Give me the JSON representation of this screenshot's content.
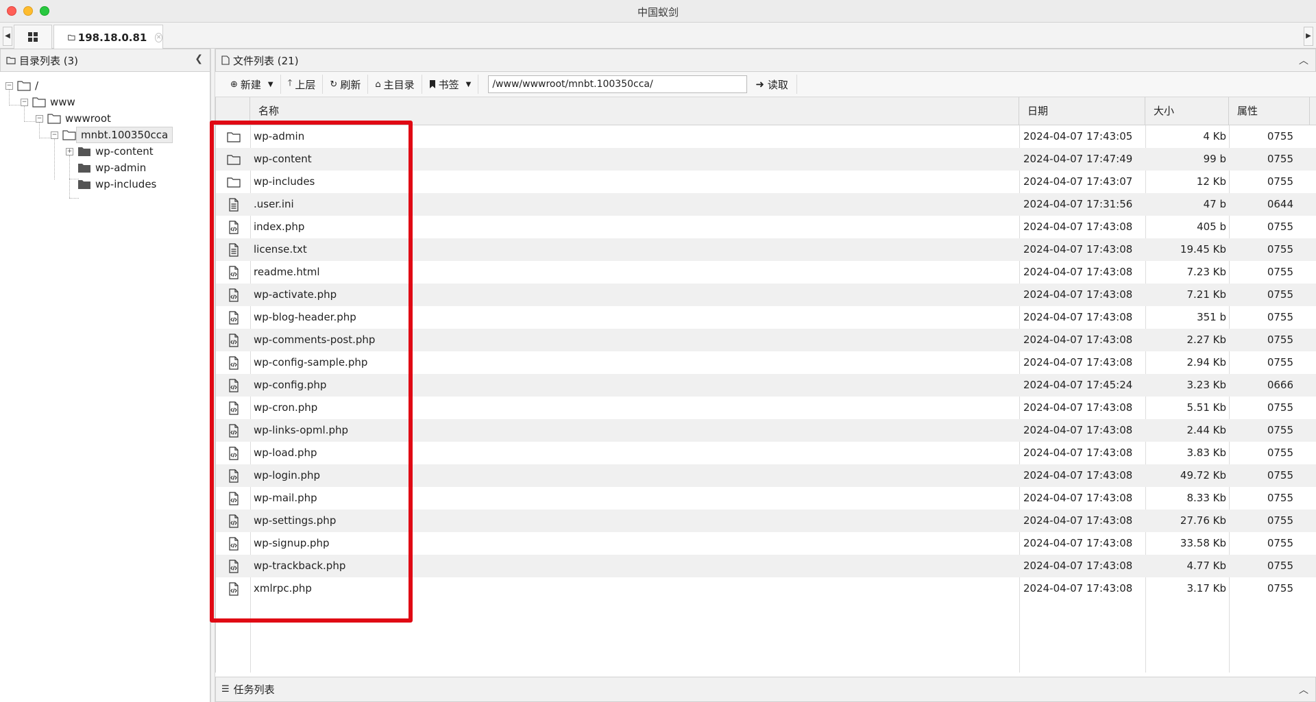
{
  "window": {
    "title": "中国蚁剑"
  },
  "tabs": [
    {
      "label": "198.18.0.81"
    }
  ],
  "left_panel": {
    "title": "目录列表 (3)",
    "tree": [
      {
        "label": "/",
        "level": 0,
        "expander": "-",
        "folder": "open"
      },
      {
        "label": "www",
        "level": 1,
        "expander": "-",
        "folder": "open"
      },
      {
        "label": "wwwroot",
        "level": 2,
        "expander": "-",
        "folder": "open"
      },
      {
        "label": "mnbt.100350cca",
        "level": 3,
        "expander": "-",
        "folder": "open",
        "selected": true
      },
      {
        "label": "wp-content",
        "level": 4,
        "expander": "+",
        "folder": "closed"
      },
      {
        "label": "wp-admin",
        "level": 4,
        "expander": "",
        "folder": "closed"
      },
      {
        "label": "wp-includes",
        "level": 4,
        "expander": "",
        "folder": "closed"
      }
    ]
  },
  "right_panel": {
    "title": "文件列表 (21)",
    "toolbar": {
      "new_label": "新建",
      "up_label": "上层",
      "refresh_label": "刷新",
      "home_label": "主目录",
      "bookmark_label": "书签",
      "path_value": "/www/wwwroot/mnbt.100350cca/",
      "read_label": "读取"
    },
    "columns": {
      "name": "名称",
      "date": "日期",
      "size": "大小",
      "attr": "属性"
    },
    "files": [
      {
        "icon": "folder-icon",
        "name": "wp-admin",
        "date": "2024-04-07 17:43:05",
        "size": "4 Kb",
        "attr": "0755"
      },
      {
        "icon": "folder-icon",
        "name": "wp-content",
        "date": "2024-04-07 17:47:49",
        "size": "99 b",
        "attr": "0755"
      },
      {
        "icon": "folder-icon",
        "name": "wp-includes",
        "date": "2024-04-07 17:43:07",
        "size": "12 Kb",
        "attr": "0755"
      },
      {
        "icon": "text-file-icon",
        "name": ".user.ini",
        "date": "2024-04-07 17:31:56",
        "size": "47 b",
        "attr": "0644"
      },
      {
        "icon": "code-file-icon",
        "name": "index.php",
        "date": "2024-04-07 17:43:08",
        "size": "405 b",
        "attr": "0755"
      },
      {
        "icon": "text-file-icon",
        "name": "license.txt",
        "date": "2024-04-07 17:43:08",
        "size": "19.45 Kb",
        "attr": "0755"
      },
      {
        "icon": "code-file-icon",
        "name": "readme.html",
        "date": "2024-04-07 17:43:08",
        "size": "7.23 Kb",
        "attr": "0755"
      },
      {
        "icon": "code-file-icon",
        "name": "wp-activate.php",
        "date": "2024-04-07 17:43:08",
        "size": "7.21 Kb",
        "attr": "0755"
      },
      {
        "icon": "code-file-icon",
        "name": "wp-blog-header.php",
        "date": "2024-04-07 17:43:08",
        "size": "351 b",
        "attr": "0755"
      },
      {
        "icon": "code-file-icon",
        "name": "wp-comments-post.php",
        "date": "2024-04-07 17:43:08",
        "size": "2.27 Kb",
        "attr": "0755"
      },
      {
        "icon": "code-file-icon",
        "name": "wp-config-sample.php",
        "date": "2024-04-07 17:43:08",
        "size": "2.94 Kb",
        "attr": "0755"
      },
      {
        "icon": "code-file-icon",
        "name": "wp-config.php",
        "date": "2024-04-07 17:45:24",
        "size": "3.23 Kb",
        "attr": "0666"
      },
      {
        "icon": "code-file-icon",
        "name": "wp-cron.php",
        "date": "2024-04-07 17:43:08",
        "size": "5.51 Kb",
        "attr": "0755"
      },
      {
        "icon": "code-file-icon",
        "name": "wp-links-opml.php",
        "date": "2024-04-07 17:43:08",
        "size": "2.44 Kb",
        "attr": "0755"
      },
      {
        "icon": "code-file-icon",
        "name": "wp-load.php",
        "date": "2024-04-07 17:43:08",
        "size": "3.83 Kb",
        "attr": "0755"
      },
      {
        "icon": "code-file-icon",
        "name": "wp-login.php",
        "date": "2024-04-07 17:43:08",
        "size": "49.72 Kb",
        "attr": "0755"
      },
      {
        "icon": "code-file-icon",
        "name": "wp-mail.php",
        "date": "2024-04-07 17:43:08",
        "size": "8.33 Kb",
        "attr": "0755"
      },
      {
        "icon": "code-file-icon",
        "name": "wp-settings.php",
        "date": "2024-04-07 17:43:08",
        "size": "27.76 Kb",
        "attr": "0755"
      },
      {
        "icon": "code-file-icon",
        "name": "wp-signup.php",
        "date": "2024-04-07 17:43:08",
        "size": "33.58 Kb",
        "attr": "0755"
      },
      {
        "icon": "code-file-icon",
        "name": "wp-trackback.php",
        "date": "2024-04-07 17:43:08",
        "size": "4.77 Kb",
        "attr": "0755"
      },
      {
        "icon": "code-file-icon",
        "name": "xmlrpc.php",
        "date": "2024-04-07 17:43:08",
        "size": "3.17 Kb",
        "attr": "0755"
      }
    ]
  },
  "task_panel": {
    "title": "任务列表"
  },
  "colors": {
    "highlight": "#e00914",
    "row_alt": "#f0f0f0"
  }
}
